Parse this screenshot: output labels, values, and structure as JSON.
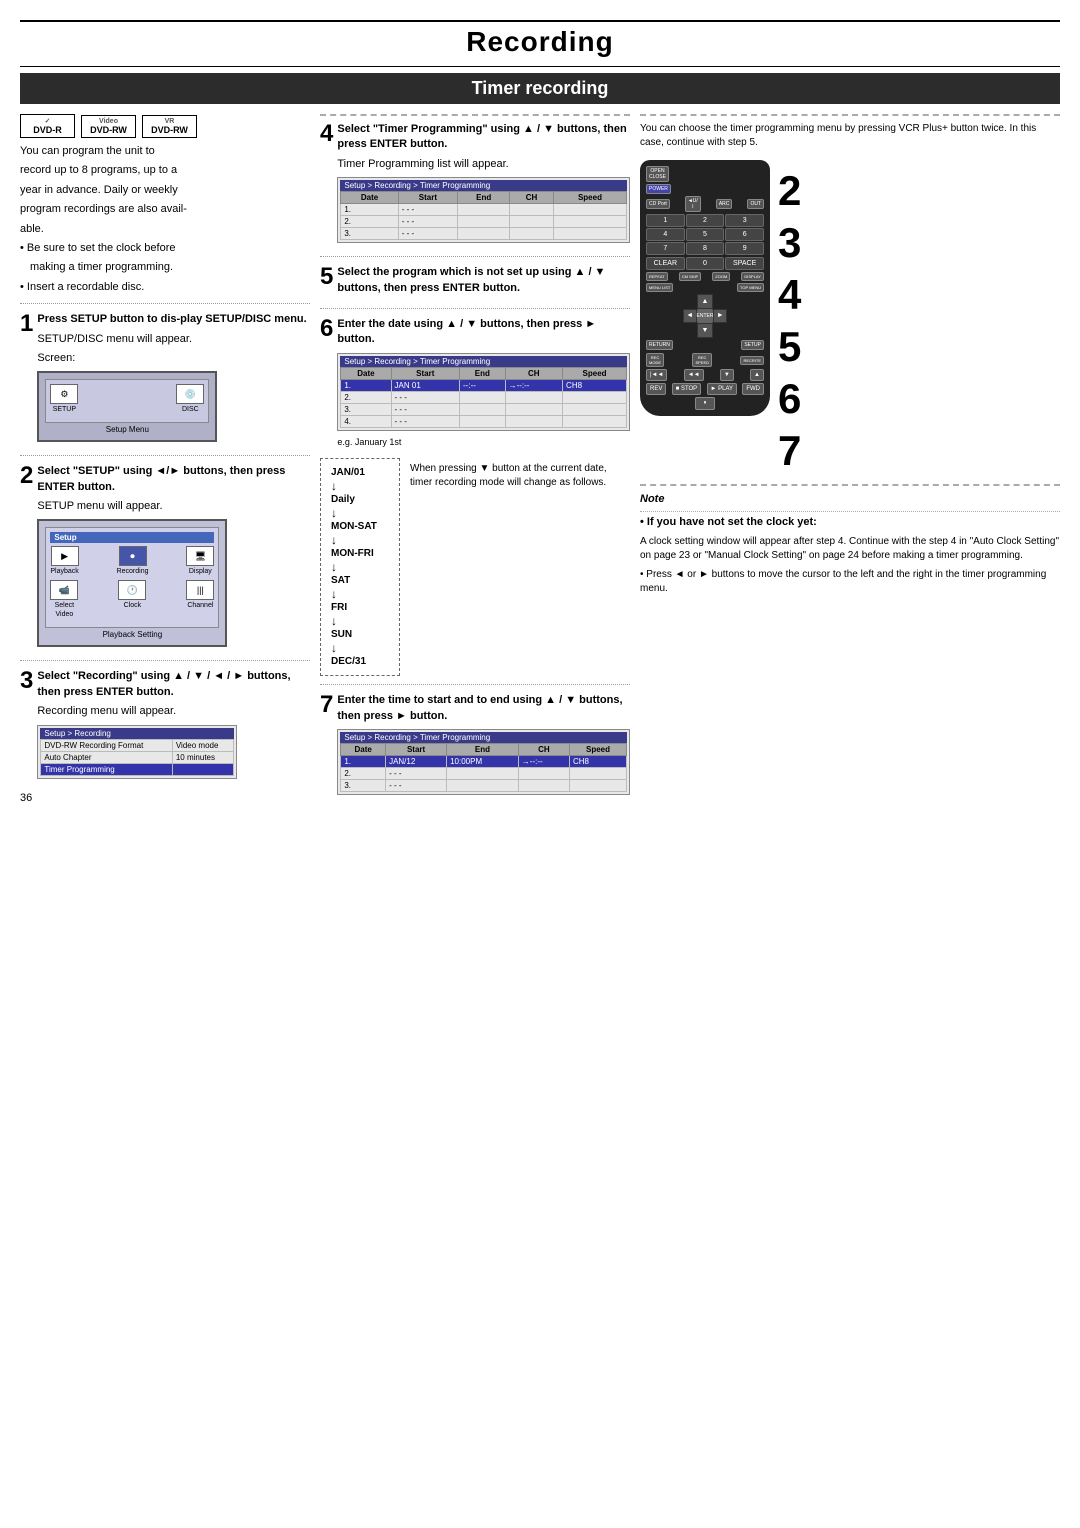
{
  "page": {
    "title": "Recording",
    "subtitle": "Timer recording",
    "page_number": "36"
  },
  "disc_logos": [
    {
      "label": "DVD-R",
      "sub": ""
    },
    {
      "label": "Video DVD-RW",
      "sub": ""
    },
    {
      "label": "VR DVD-RW",
      "sub": ""
    }
  ],
  "intro": {
    "line1": "You can program the unit to",
    "line2": "record up to 8 programs, up to a",
    "line3": "year in advance. Daily or weekly",
    "line4": "program recordings are also avail-",
    "line5": "able.",
    "bullet1": "• Be sure to set the clock before",
    "bullet1b": "making a timer programming.",
    "bullet2": "• Insert a recordable disc."
  },
  "steps": {
    "step1": {
      "num": "1",
      "title": "Press SETUP button to dis-play SETUP/DISC menu.",
      "body": "SETUP/DISC menu will appear.",
      "screen_label": "Screen:",
      "menu_label": "Setup Menu",
      "screen_items": [
        "SETUP",
        "DISC"
      ]
    },
    "step2": {
      "num": "2",
      "title": "Select \"SETUP\" using ◄/► buttons, then press ENTER button.",
      "body": "SETUP menu will appear.",
      "screen_items": [
        "Playback",
        "Recording",
        "Display",
        "Select Video",
        "Clock",
        "Channel"
      ],
      "screen_label": "Playback Setting"
    },
    "step3": {
      "num": "3",
      "title": "Select \"Recording\" using ▲ / ▼ / ◄ / ► buttons, then press ENTER button.",
      "body": "Recording menu will appear.",
      "screen_title": "Setup > Recording",
      "screen_rows": [
        {
          "label": "DVD-RW Recording Format",
          "value": "Video mode"
        },
        {
          "label": "Auto Chapter",
          "value": "10 minutes"
        },
        {
          "label": "Timer Programming",
          "value": ""
        }
      ]
    },
    "step4": {
      "num": "4",
      "title": "Select \"Timer Programming\" using ▲ / ▼ buttons, then press ENTER button.",
      "body": "Timer Programming list will appear.",
      "screen_title": "Setup > Recording > Timer Programming",
      "table_headers": [
        "Date",
        "Start",
        "End",
        "CH",
        "Speed"
      ],
      "table_rows": [
        {
          "num": "1.",
          "date": "- - -",
          "start": "",
          "end": "",
          "ch": "",
          "speed": ""
        },
        {
          "num": "2.",
          "date": "- - -",
          "start": "",
          "end": "",
          "ch": "",
          "speed": ""
        },
        {
          "num": "3.",
          "date": "- - -",
          "start": "",
          "end": "",
          "ch": "",
          "speed": ""
        }
      ]
    },
    "step4_note": "You can choose the timer programming menu by pressing VCR Plus+ button twice. In this case, continue with step 5.",
    "step5": {
      "num": "5",
      "title": "Select the program which is not set up using ▲ / ▼ buttons, then press ENTER button."
    },
    "step6": {
      "num": "6",
      "title": "Enter the date using ▲ / ▼ buttons, then press ► button.",
      "screen_title": "Setup > Recording > Timer Programming",
      "table_headers": [
        "Date",
        "Start",
        "End",
        "CH",
        "Speed"
      ],
      "table_rows": [
        {
          "num": "1.",
          "date": "JAN 01",
          "start": "- - : - -",
          "end": "→ - : - -",
          "ch": "CH8",
          "speed": ""
        },
        {
          "num": "2.",
          "date": "- - -",
          "start": "",
          "end": "",
          "ch": "",
          "speed": ""
        },
        {
          "num": "3.",
          "date": "- - -",
          "start": "",
          "end": "",
          "ch": "",
          "speed": ""
        },
        {
          "num": "4.",
          "date": "- - -",
          "start": "",
          "end": "",
          "ch": "",
          "speed": ""
        }
      ],
      "example": "e.g. January 1st",
      "date_chain": [
        "JAN/01",
        "Daily",
        "MON-SAT",
        "MON-FRI",
        "SAT",
        "FRI",
        "SUN",
        "DEC/31"
      ],
      "when_pressing": "When pressing ▼ button at the current date, timer recording mode will change as follows."
    },
    "step7": {
      "num": "7",
      "title": "Enter the time to start and to end using ▲ / ▼ buttons, then press ► button.",
      "screen_title": "Setup > Recording > Timer Programming",
      "table_headers": [
        "Date",
        "Start",
        "End",
        "CH",
        "Speed"
      ],
      "table_rows": [
        {
          "num": "1.",
          "date": "JAN/12",
          "start": "10:00PM",
          "end": "→ - : - -",
          "ch": "CH8",
          "speed": ""
        },
        {
          "num": "2.",
          "date": "- - -",
          "start": "",
          "end": "",
          "ch": "",
          "speed": ""
        },
        {
          "num": "3.",
          "date": "- - -",
          "start": "",
          "end": "",
          "ch": "",
          "speed": ""
        }
      ]
    }
  },
  "note": {
    "title": "Note",
    "if_not_set": "• If you have not set the clock yet:",
    "body1": "A clock setting window will appear after step 4. Continue with the step 4 in \"Auto Clock Setting\" on page 23 or \"Manual Clock Setting\" on page 24 before making a timer programming.",
    "body2": "• Press ◄ or ► buttons to move the cursor to the left and the right in the timer programming menu."
  },
  "press_note": {
    "text": "Press"
  },
  "right_step_numbers": [
    "2",
    "3",
    "4",
    "5",
    "6",
    "7"
  ],
  "labels": {
    "setup": "SETUP",
    "disc": "DISC",
    "setup_menu": "Setup Menu",
    "playback_setting": "Playback Setting",
    "playback": "Playback",
    "recording": "Recording",
    "display": "Display",
    "select_video": "Select\nVideo",
    "clock": "Clock",
    "channel": "Channel"
  }
}
